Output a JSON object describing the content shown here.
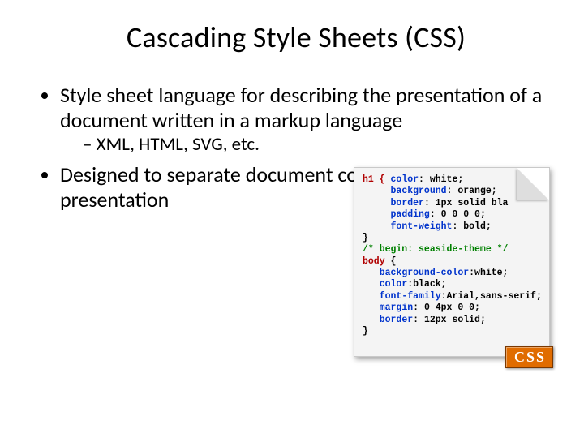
{
  "title": "Cascading Style Sheets (CSS)",
  "bullets": {
    "b1": "Style sheet language for describing the presentation of a document written in a markup language",
    "b1_sub": "XML, HTML, SVG, etc.",
    "b2": "Designed to separate document content from document presentation"
  },
  "code": {
    "l1a": "h1 { ",
    "l1b": "color",
    "l1c": ": white;",
    "l2a": "background",
    "l2b": ": orange;",
    "l3a": "border",
    "l3b": ": 1px solid bla",
    "l4a": "padding",
    "l4b": ": 0 0 0 0;",
    "l5a": "font-weight",
    "l5b": ": bold;",
    "l6": "}",
    "l7": "/* begin: seaside-theme */",
    "l8a": "body",
    "l8b": " {",
    "l9a": "background-color",
    "l9b": ":white;",
    "l10a": "color",
    "l10b": ":black;",
    "l11a": "font-family",
    "l11b": ":Arial,sans-serif;",
    "l12a": "margin",
    "l12b": ": 0 4px 0 0;",
    "l13a": "border",
    "l13b": ": 12px solid;",
    "l14": "}"
  },
  "badge": "CSS"
}
